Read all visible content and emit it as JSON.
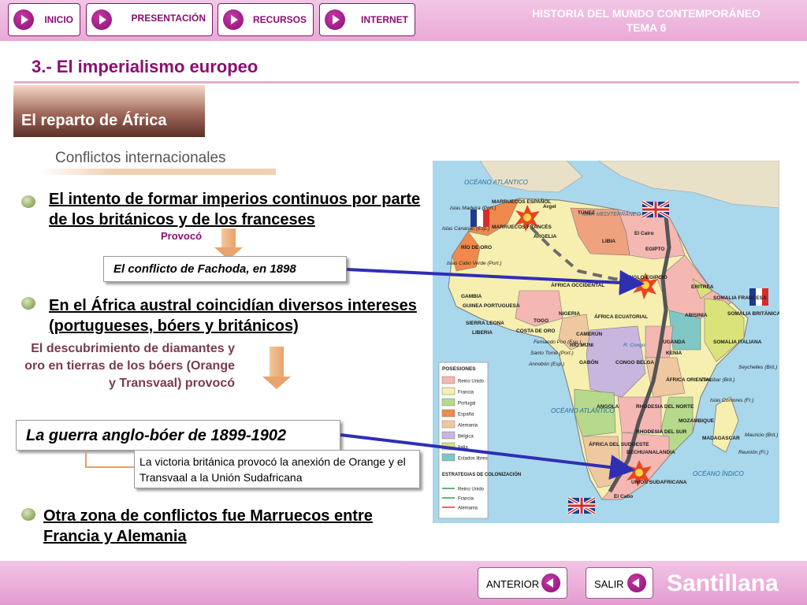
{
  "header": {
    "nav": [
      {
        "label": "INICIO"
      },
      {
        "label": "PRESENTACIÓN"
      },
      {
        "label": "RECURSOS"
      },
      {
        "label": "INTERNET"
      }
    ],
    "title_line1": "HISTORIA DEL MUNDO CONTEMPORÁNEO",
    "title_line2": "TEMA 6"
  },
  "section_title": "3.- El imperialismo europeo",
  "tab_label": "El reparto de África",
  "subtitle": "Conflictos internacionales",
  "block1": {
    "text": "El intento de formar imperios continuos por parte de los británicos y de los franceses",
    "arrow_label": "Provocó",
    "callout": "El conflicto de Fachoda, en 1898"
  },
  "block2": {
    "text": "En el África austral coincidían diversos intereses (portugueses, bóers y británicos)",
    "description": "El descubrimiento de diamantes y oro en tierras de los bóers (Orange y Transvaal) provocó",
    "callout": "La guerra anglo-bóer de 1899-1902",
    "note": "La victoria británica provocó la anexión de Orange y el Transvaal a la Unión Sudafricana"
  },
  "block3": {
    "text": "Otra zona de conflictos fue Marruecos entre Francia y Alemania"
  },
  "map": {
    "ocean_atlantic_top": "OCÉANO ATLÁNTICO",
    "ocean_atlantic_mid": "OCÉANO ATLÁNTICO",
    "ocean_indian": "OCÉANO ÍNDICO",
    "mediterranean": "MAR MEDITERRÁNEO",
    "labels": [
      "MARRUECOS ESPAÑOL",
      "MARRUECOS FRANCÉS",
      "ARGELIA",
      "TÚNEZ",
      "LIBIA",
      "EGIPTO",
      "RÍO DE ORO",
      "ÁFRICA OCCIDENTAL",
      "ANGLO-EGIPCIO",
      "ERITREA",
      "SOMALIA FRANCESA",
      "SOMALIA BRITÁNICA",
      "ABISINIA",
      "SOMALIA ITALIANA",
      "GAMBIA",
      "GUINEA PORTUGUESA",
      "SIERRA LEONA",
      "LIBERIA",
      "COSTA DE ORO",
      "TOGO",
      "NIGERIA",
      "CAMERÚN",
      "RÍO MUNI",
      "GABÓN",
      "ÁFRICA ECUATORIAL",
      "CONGO BELGA",
      "UGANDA",
      "KENIA",
      "ÁFRICA ORIENTAL",
      "ANGOLA",
      "RHODESIA DEL NORTE",
      "RHODESIA DEL SUR",
      "MOZAMBIQUE",
      "ÁFRICA DEL SUDOESTE",
      "BECHUANALANDIA",
      "UNIÓN SUDAFRICANA",
      "MADAGASCAR",
      "El Cairo",
      "El Cabo",
      "Argel",
      "Islas Madeira (Port.)",
      "Islas Canarias (Esp.)",
      "Islas Cabo Verde (Port.)",
      "Fernando Poo (Esp.)",
      "Santo Tomé (Port.)",
      "Annobón (Esp.)",
      "Zanzíbar (Brit.)",
      "Seychelles (Brit.)",
      "Islas Comores (Fr.)",
      "Mauricio (Brit.)",
      "Reunión (Fr.)",
      "R. Congo"
    ],
    "legend_title": "POSESIONES",
    "legend": [
      {
        "label": "Reino Unido",
        "color": "#f4b7b2"
      },
      {
        "label": "Francia",
        "color": "#f6efb0"
      },
      {
        "label": "Portugal",
        "color": "#b6d98c"
      },
      {
        "label": "España",
        "color": "#ef8a4c"
      },
      {
        "label": "Alemania",
        "color": "#f0c8a0"
      },
      {
        "label": "Bélgica",
        "color": "#c9b6df"
      },
      {
        "label": "Italia",
        "color": "#d9e37a"
      },
      {
        "label": "Estados libres",
        "color": "#7fc7c4"
      }
    ],
    "strategies_title": "ESTRATEGIAS DE COLONIZACIÓN",
    "strategies": [
      {
        "label": "Reino Unido",
        "color": "#2e9b4a"
      },
      {
        "label": "Francia",
        "color": "#2e9b4a"
      },
      {
        "label": "Alemania",
        "color": "#d83b3b"
      }
    ]
  },
  "footer": {
    "prev_label": "ANTERIOR",
    "exit_label": "SALIR",
    "brand": "Santillana"
  }
}
